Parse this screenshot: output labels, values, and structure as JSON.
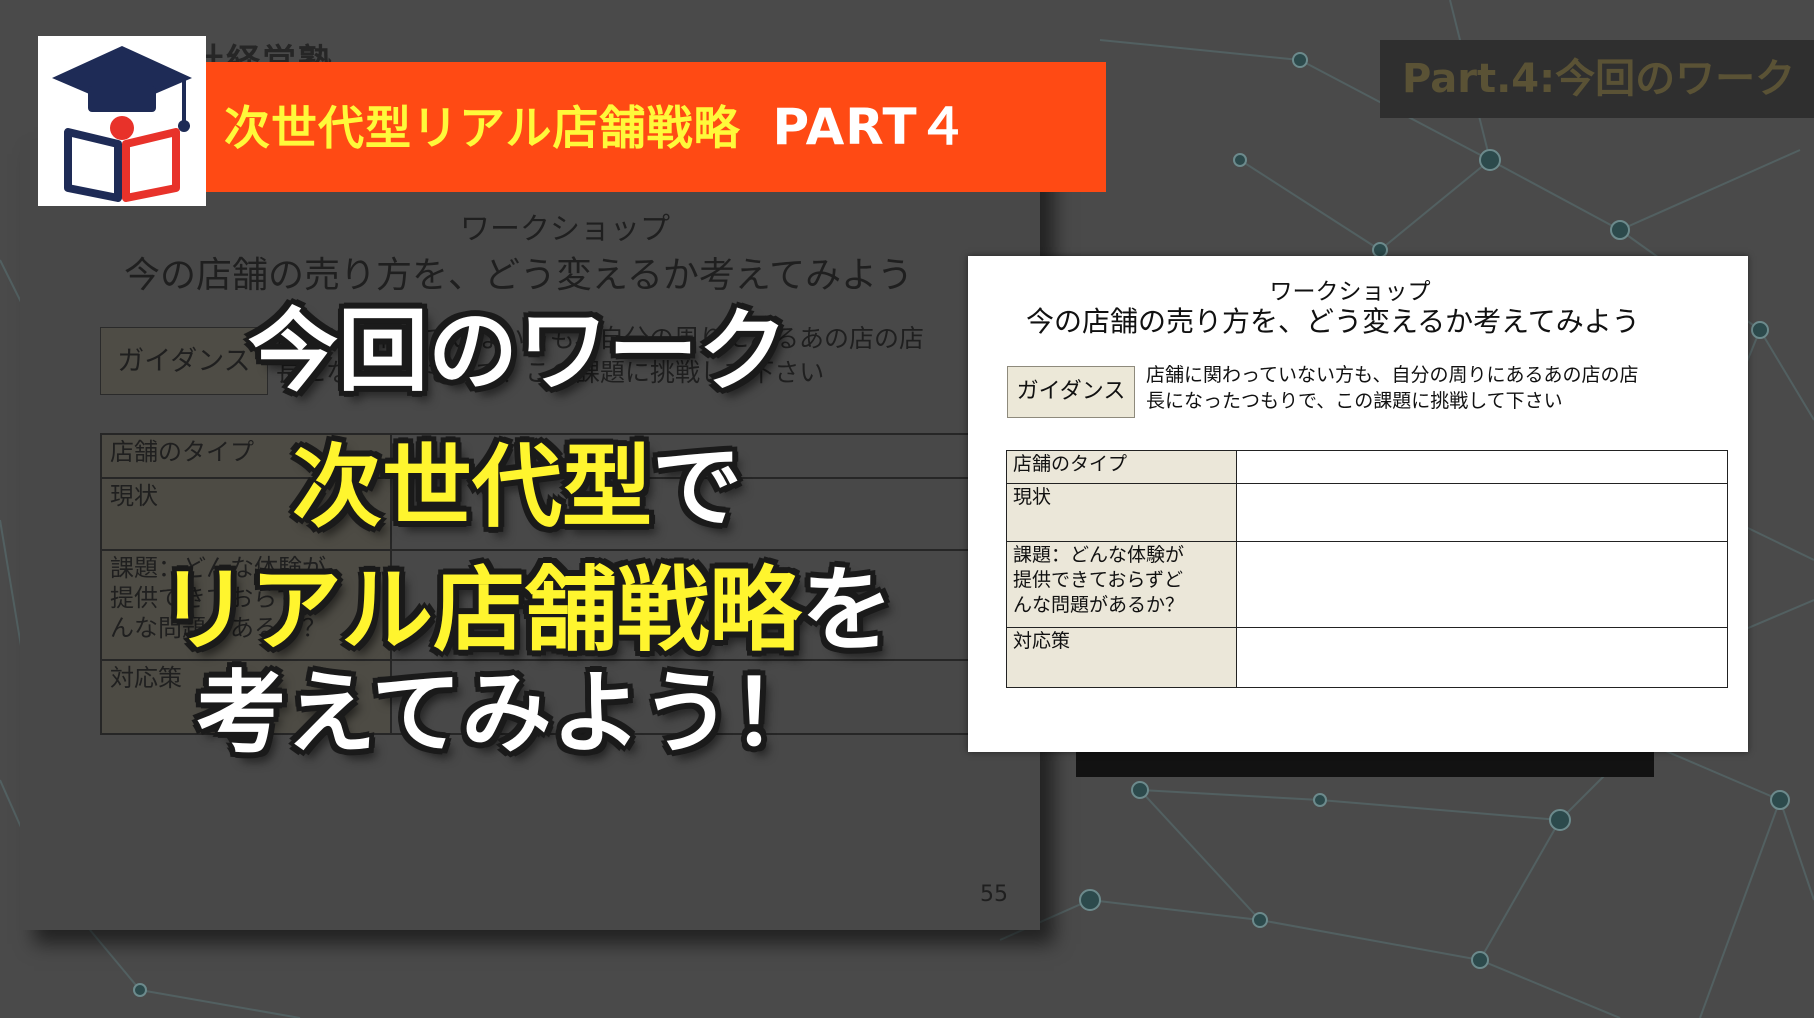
{
  "header": {
    "title": "次世代型リアル店舗戦略",
    "part": "PART４",
    "school_name_faded": "社経営塾"
  },
  "part_badge": "Part.4:今回のワーク",
  "headlines": {
    "line1": "今回のワーク",
    "line2_yellow": "次世代型",
    "line2_white": "で",
    "line3_yellow": "リアル店舗戦略",
    "line3_white": "を",
    "line4": "考えてみよう！"
  },
  "slide": {
    "subtitle": "ワークショップ",
    "title": "今の店舗の売り方を、どう変えるか考えてみよう",
    "guidance_label": "ガイダンス",
    "guidance_line1": "店舗に関わっていない方も、自分の周りにあるあの店の店",
    "guidance_line2": "長になったつもりで、この課題に挑戦して下さい",
    "rows": [
      {
        "label": "店舗のタイプ"
      },
      {
        "label": "現状"
      },
      {
        "label_line1": "課題：どんな体験が",
        "label_line2": "提供できておらずど",
        "label_line3": "んな問題があるか？"
      },
      {
        "label": "対応策"
      }
    ],
    "page_number": "55"
  },
  "colors": {
    "banner_bg": "#ff4a14",
    "banner_text": "#fff93a",
    "headline_yellow": "#fff52e",
    "background": "#4a4a4a",
    "card_label_bg": "#ebe7d9"
  },
  "icons": {
    "logo": "graduation-cap-book-icon"
  }
}
